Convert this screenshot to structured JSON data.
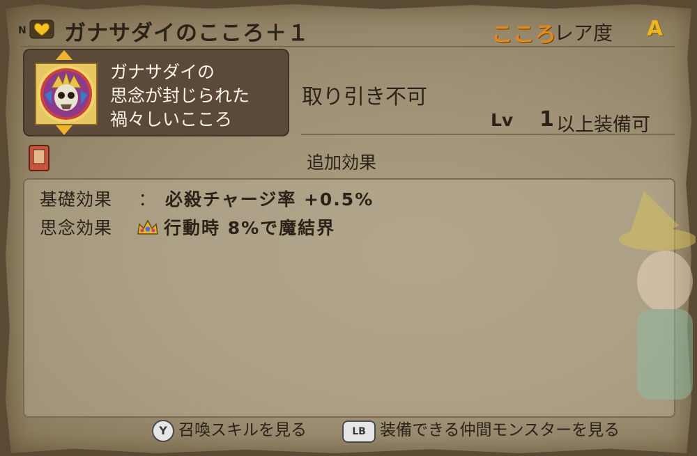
{
  "header": {
    "rank": "N",
    "title": "ガナサダイのこころ＋１",
    "category": "こころ",
    "rarity_label": "レア度",
    "rarity_value": "A"
  },
  "item": {
    "icon": "skull-demon-icon",
    "description": [
      "ガナサダイの",
      "思念が封じられた",
      "禍々しいこころ"
    ],
    "trade_status": "取り引き不可",
    "level_label": "Lv",
    "level_value": "1",
    "level_suffix": "以上装備可"
  },
  "effects": {
    "section_label": "追加効果",
    "rows": [
      {
        "label": "基礎効果",
        "colon": "：",
        "value": "必殺チャージ率 +0.5%"
      },
      {
        "label": "思念効果",
        "colon": "",
        "value": "行動時 8%で魔結界",
        "icon": "crown-icon"
      }
    ]
  },
  "footer": {
    "summon_button": "Y",
    "summon_label": "召喚スキルを見る",
    "equip_button": "LB",
    "equip_label": "装備できる仲間モンスターを見る"
  },
  "colors": {
    "kokoro": "#e08a1c",
    "rarity": "#ecb51a",
    "desc_box": "#5b4a3a",
    "parchment": "#a89b80"
  }
}
